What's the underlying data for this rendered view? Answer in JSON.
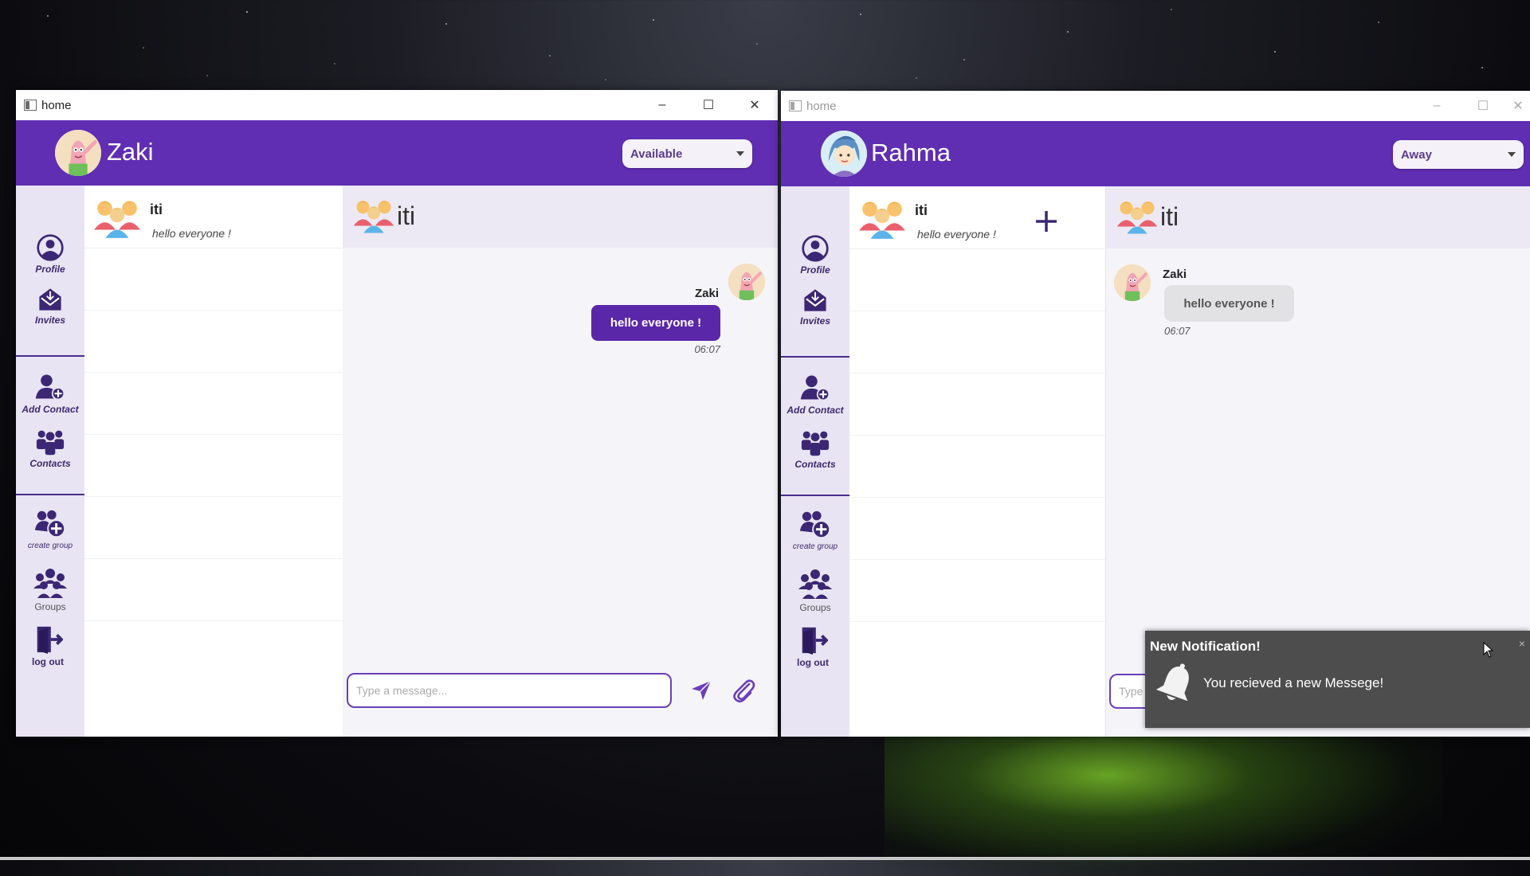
{
  "windows": [
    {
      "title": "home",
      "user": {
        "name": "Zaki",
        "status": "Available"
      },
      "nav": {
        "profile": "Profile",
        "invites": "Invites",
        "add_contact": "Add Contact",
        "contacts": "Contacts",
        "create_group": "create group",
        "groups": "Groups",
        "logout": "log out"
      },
      "conversation": {
        "name": "iti",
        "last_message": "hello everyone !"
      },
      "chat": {
        "title": "iti",
        "messages": [
          {
            "sender": "Zaki",
            "text": "hello everyone !",
            "time": "06:07",
            "direction": "outgoing"
          }
        ],
        "input_placeholder": "Type a message..."
      }
    },
    {
      "title": "home",
      "user": {
        "name": "Rahma",
        "status": "Away"
      },
      "nav": {
        "profile": "Profile",
        "invites": "Invites",
        "add_contact": "Add Contact",
        "contacts": "Contacts",
        "create_group": "create group",
        "groups": "Groups",
        "logout": "log out"
      },
      "conversation": {
        "name": "iti",
        "last_message": "hello everyone !"
      },
      "chat": {
        "title": "iti",
        "messages": [
          {
            "sender": "Zaki",
            "text": "hello everyone !",
            "time": "06:07",
            "direction": "incoming"
          }
        ],
        "input_placeholder": "Type a message..."
      }
    }
  ],
  "notification": {
    "title": "New Notification!",
    "close": "×",
    "text": "You recieved a new Messege!"
  },
  "colors": {
    "accent": "#5f2eb2",
    "bubble_out": "#5a27a9",
    "bubble_in": "#e2e2e4",
    "sidebar": "#e9e4f3"
  },
  "icons": [
    "user-circle-icon",
    "mail-icon",
    "add-user-icon",
    "contacts-icon",
    "create-group-icon",
    "groups-icon",
    "logout-icon",
    "send-icon",
    "paperclip-icon",
    "plus-icon",
    "bell-icon",
    "group-avatar-icon"
  ]
}
